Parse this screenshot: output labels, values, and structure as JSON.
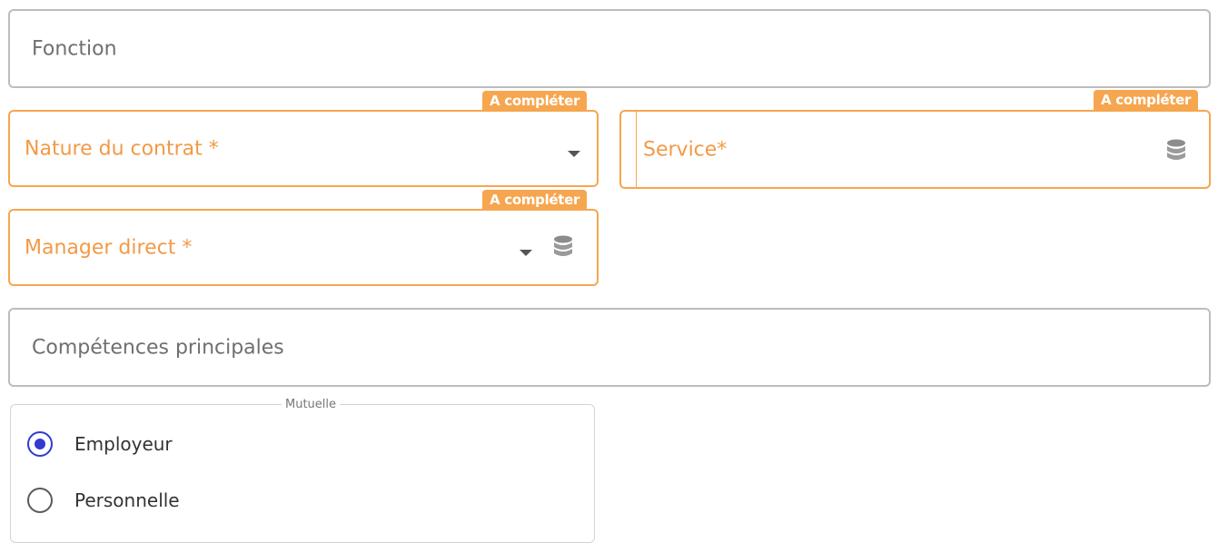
{
  "fields": {
    "fonction": {
      "placeholder": "Fonction"
    },
    "nature_contrat": {
      "label": "Nature du contrat *",
      "badge": "A compléter"
    },
    "service": {
      "label": "Service*",
      "badge": "A compléter"
    },
    "manager": {
      "label": "Manager direct *",
      "badge": "A compléter"
    },
    "competences": {
      "placeholder": "Compétences principales"
    }
  },
  "mutuelle": {
    "legend": "Mutuelle",
    "options": [
      {
        "label": "Employeur",
        "selected": true
      },
      {
        "label": "Personnelle",
        "selected": false
      }
    ]
  },
  "colors": {
    "warning": "#f6a64f",
    "warning_text": "#f29a45",
    "radio_selected": "#2f3bd1",
    "border": "#bdbdbd"
  },
  "icons": [
    "chevron-down-icon",
    "database-icon"
  ]
}
